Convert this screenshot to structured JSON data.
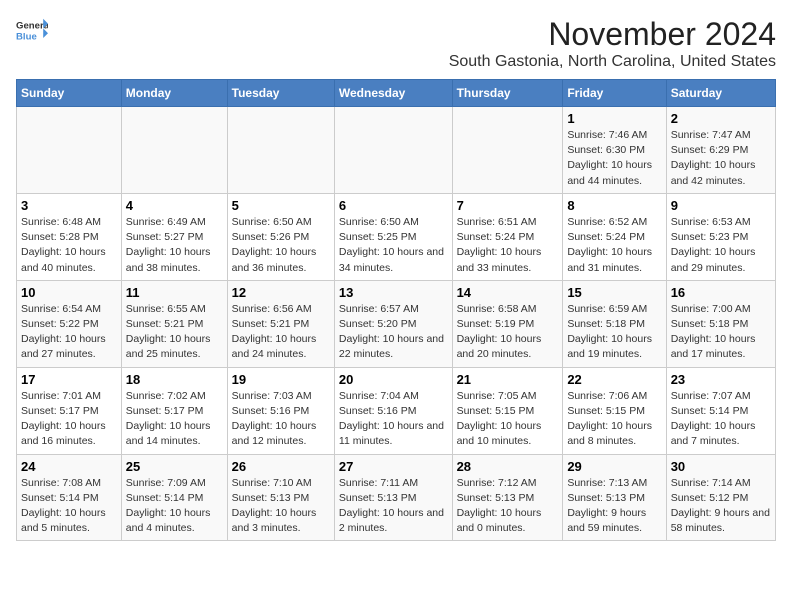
{
  "header": {
    "logo_general": "General",
    "logo_blue": "Blue",
    "title": "November 2024",
    "subtitle": "South Gastonia, North Carolina, United States"
  },
  "weekdays": [
    "Sunday",
    "Monday",
    "Tuesday",
    "Wednesday",
    "Thursday",
    "Friday",
    "Saturday"
  ],
  "weeks": [
    [
      {
        "day": "",
        "info": ""
      },
      {
        "day": "",
        "info": ""
      },
      {
        "day": "",
        "info": ""
      },
      {
        "day": "",
        "info": ""
      },
      {
        "day": "",
        "info": ""
      },
      {
        "day": "1",
        "info": "Sunrise: 7:46 AM\nSunset: 6:30 PM\nDaylight: 10 hours and 44 minutes."
      },
      {
        "day": "2",
        "info": "Sunrise: 7:47 AM\nSunset: 6:29 PM\nDaylight: 10 hours and 42 minutes."
      }
    ],
    [
      {
        "day": "3",
        "info": "Sunrise: 6:48 AM\nSunset: 5:28 PM\nDaylight: 10 hours and 40 minutes."
      },
      {
        "day": "4",
        "info": "Sunrise: 6:49 AM\nSunset: 5:27 PM\nDaylight: 10 hours and 38 minutes."
      },
      {
        "day": "5",
        "info": "Sunrise: 6:50 AM\nSunset: 5:26 PM\nDaylight: 10 hours and 36 minutes."
      },
      {
        "day": "6",
        "info": "Sunrise: 6:50 AM\nSunset: 5:25 PM\nDaylight: 10 hours and 34 minutes."
      },
      {
        "day": "7",
        "info": "Sunrise: 6:51 AM\nSunset: 5:24 PM\nDaylight: 10 hours and 33 minutes."
      },
      {
        "day": "8",
        "info": "Sunrise: 6:52 AM\nSunset: 5:24 PM\nDaylight: 10 hours and 31 minutes."
      },
      {
        "day": "9",
        "info": "Sunrise: 6:53 AM\nSunset: 5:23 PM\nDaylight: 10 hours and 29 minutes."
      }
    ],
    [
      {
        "day": "10",
        "info": "Sunrise: 6:54 AM\nSunset: 5:22 PM\nDaylight: 10 hours and 27 minutes."
      },
      {
        "day": "11",
        "info": "Sunrise: 6:55 AM\nSunset: 5:21 PM\nDaylight: 10 hours and 25 minutes."
      },
      {
        "day": "12",
        "info": "Sunrise: 6:56 AM\nSunset: 5:21 PM\nDaylight: 10 hours and 24 minutes."
      },
      {
        "day": "13",
        "info": "Sunrise: 6:57 AM\nSunset: 5:20 PM\nDaylight: 10 hours and 22 minutes."
      },
      {
        "day": "14",
        "info": "Sunrise: 6:58 AM\nSunset: 5:19 PM\nDaylight: 10 hours and 20 minutes."
      },
      {
        "day": "15",
        "info": "Sunrise: 6:59 AM\nSunset: 5:18 PM\nDaylight: 10 hours and 19 minutes."
      },
      {
        "day": "16",
        "info": "Sunrise: 7:00 AM\nSunset: 5:18 PM\nDaylight: 10 hours and 17 minutes."
      }
    ],
    [
      {
        "day": "17",
        "info": "Sunrise: 7:01 AM\nSunset: 5:17 PM\nDaylight: 10 hours and 16 minutes."
      },
      {
        "day": "18",
        "info": "Sunrise: 7:02 AM\nSunset: 5:17 PM\nDaylight: 10 hours and 14 minutes."
      },
      {
        "day": "19",
        "info": "Sunrise: 7:03 AM\nSunset: 5:16 PM\nDaylight: 10 hours and 12 minutes."
      },
      {
        "day": "20",
        "info": "Sunrise: 7:04 AM\nSunset: 5:16 PM\nDaylight: 10 hours and 11 minutes."
      },
      {
        "day": "21",
        "info": "Sunrise: 7:05 AM\nSunset: 5:15 PM\nDaylight: 10 hours and 10 minutes."
      },
      {
        "day": "22",
        "info": "Sunrise: 7:06 AM\nSunset: 5:15 PM\nDaylight: 10 hours and 8 minutes."
      },
      {
        "day": "23",
        "info": "Sunrise: 7:07 AM\nSunset: 5:14 PM\nDaylight: 10 hours and 7 minutes."
      }
    ],
    [
      {
        "day": "24",
        "info": "Sunrise: 7:08 AM\nSunset: 5:14 PM\nDaylight: 10 hours and 5 minutes."
      },
      {
        "day": "25",
        "info": "Sunrise: 7:09 AM\nSunset: 5:14 PM\nDaylight: 10 hours and 4 minutes."
      },
      {
        "day": "26",
        "info": "Sunrise: 7:10 AM\nSunset: 5:13 PM\nDaylight: 10 hours and 3 minutes."
      },
      {
        "day": "27",
        "info": "Sunrise: 7:11 AM\nSunset: 5:13 PM\nDaylight: 10 hours and 2 minutes."
      },
      {
        "day": "28",
        "info": "Sunrise: 7:12 AM\nSunset: 5:13 PM\nDaylight: 10 hours and 0 minutes."
      },
      {
        "day": "29",
        "info": "Sunrise: 7:13 AM\nSunset: 5:13 PM\nDaylight: 9 hours and 59 minutes."
      },
      {
        "day": "30",
        "info": "Sunrise: 7:14 AM\nSunset: 5:12 PM\nDaylight: 9 hours and 58 minutes."
      }
    ]
  ]
}
